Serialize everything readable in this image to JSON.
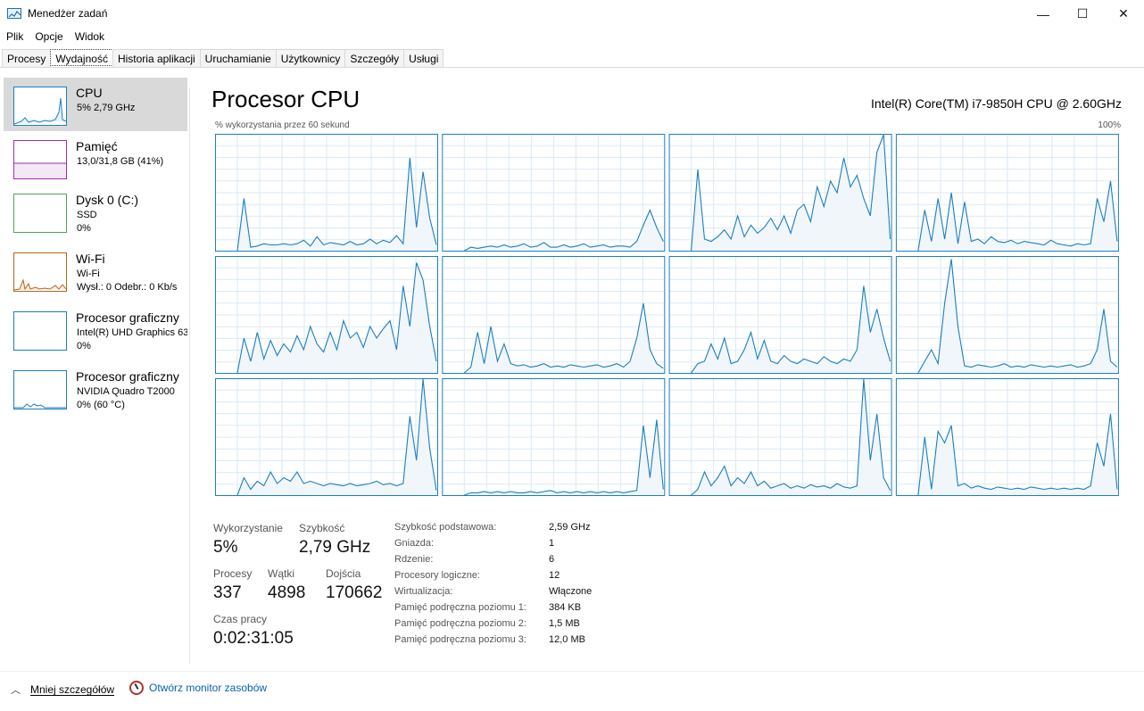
{
  "window": {
    "title": "Menedżer zadań",
    "minimize_glyph": "—",
    "maximize_glyph": "☐",
    "close_glyph": "✕"
  },
  "menu": [
    "Plik",
    "Opcje",
    "Widok"
  ],
  "tabs": [
    "Procesy",
    "Wydajność",
    "Historia aplikacji",
    "Uruchamianie",
    "Użytkownicy",
    "Szczegóły",
    "Usługi"
  ],
  "active_tab": "Wydajność",
  "sidebar": [
    {
      "title": "CPU",
      "lines": [
        "5% 2,79 GHz"
      ],
      "color": "#1a7fc1"
    },
    {
      "title": "Pamięć",
      "lines": [
        "13,0/31,8 GB (41%)"
      ],
      "color": "#9b30a8"
    },
    {
      "title": "Dysk 0 (C:)",
      "lines": [
        "SSD",
        "0%"
      ],
      "color": "#4da74d"
    },
    {
      "title": "Wi-Fi",
      "lines": [
        "Wi-Fi",
        "Wysł.: 0 Odebr.: 0 Kb/s"
      ],
      "color": "#b3661e"
    },
    {
      "title": "Procesor graficzny",
      "lines": [
        "Intel(R) UHD Graphics 63",
        "0%"
      ],
      "color": "#1a7fc1"
    },
    {
      "title": "Procesor graficzny",
      "lines": [
        "NVIDIA Quadro T2000",
        "0% (60 °C)"
      ],
      "color": "#1a7fc1"
    }
  ],
  "main": {
    "title": "Procesor CPU",
    "cpu_model": "Intel(R) Core(TM) i7-9850H CPU @ 2.60GHz",
    "axis_label": "% wykorzystania przez 60 sekund",
    "axis_max": "100%"
  },
  "stats": {
    "utilization_label": "Wykorzystanie",
    "utilization": "5%",
    "speed_label": "Szybkość",
    "speed": "2,79 GHz",
    "processes_label": "Procesy",
    "processes": "337",
    "threads_label": "Wątki",
    "threads": "4898",
    "handles_label": "Dojścia",
    "handles": "170662",
    "uptime_label": "Czas pracy",
    "uptime": "0:02:31:05"
  },
  "specs": [
    {
      "k": "Szybkość podstawowa:",
      "v": "2,59 GHz"
    },
    {
      "k": "Gniazda:",
      "v": "1"
    },
    {
      "k": "Rdzenie:",
      "v": "6"
    },
    {
      "k": "Procesory logiczne:",
      "v": "12"
    },
    {
      "k": "Wirtualizacja:",
      "v": "Włączone"
    },
    {
      "k": "Pamięć podręczna poziomu 1:",
      "v": "384 KB"
    },
    {
      "k": "Pamięć podręczna poziomu 2:",
      "v": "1,5 MB"
    },
    {
      "k": "Pamięć podręczna poziomu 3:",
      "v": "12,0 MB"
    }
  ],
  "footer": {
    "fewer_details": "Mniej szczegółów",
    "open_monitor": "Otwórz monitor zasobów"
  },
  "colors": {
    "cpu_line": "#1a7fc1",
    "cpu_fill": "#f1f6fb",
    "grid": "#d9eaf6"
  },
  "chart_data": {
    "type": "area",
    "ylim": [
      0,
      100
    ],
    "x_window_seconds": 60,
    "series": [
      {
        "values": [
          0,
          45,
          3,
          4,
          6,
          5,
          5,
          6,
          5,
          6,
          9,
          4,
          12,
          5,
          7,
          6,
          5,
          8,
          5,
          6,
          10,
          6,
          9,
          7,
          13,
          6,
          80,
          20,
          68,
          28,
          5
        ]
      },
      {
        "values": [
          0,
          3,
          2,
          3,
          4,
          3,
          5,
          3,
          4,
          6,
          3,
          4,
          7,
          3,
          3,
          5,
          3,
          4,
          6,
          3,
          4,
          5,
          3,
          4,
          4,
          3,
          8,
          22,
          35,
          20,
          8
        ]
      },
      {
        "values": [
          0,
          70,
          10,
          8,
          12,
          18,
          10,
          30,
          12,
          22,
          15,
          20,
          28,
          18,
          30,
          15,
          35,
          40,
          25,
          55,
          38,
          60,
          50,
          80,
          55,
          65,
          45,
          30,
          85,
          100,
          10
        ]
      },
      {
        "values": [
          0,
          35,
          8,
          45,
          10,
          50,
          6,
          42,
          8,
          10,
          6,
          12,
          8,
          7,
          9,
          6,
          8,
          7,
          6,
          5,
          9,
          6,
          5,
          4,
          6,
          5,
          6,
          45,
          25,
          60,
          8
        ]
      },
      {
        "values": [
          0,
          30,
          10,
          35,
          12,
          28,
          15,
          25,
          18,
          32,
          20,
          40,
          25,
          18,
          35,
          20,
          45,
          30,
          35,
          22,
          40,
          30,
          38,
          45,
          20,
          75,
          40,
          95,
          80,
          40,
          10
        ]
      },
      {
        "values": [
          0,
          5,
          35,
          8,
          40,
          10,
          25,
          8,
          6,
          7,
          5,
          6,
          8,
          5,
          6,
          5,
          7,
          6,
          5,
          6,
          7,
          5,
          6,
          8,
          5,
          10,
          30,
          60,
          20,
          8,
          4
        ]
      },
      {
        "values": [
          0,
          8,
          10,
          25,
          12,
          30,
          8,
          10,
          20,
          35,
          12,
          28,
          10,
          8,
          15,
          10,
          8,
          12,
          10,
          8,
          14,
          10,
          8,
          12,
          10,
          20,
          75,
          35,
          55,
          30,
          10
        ]
      },
      {
        "values": [
          0,
          10,
          20,
          8,
          60,
          98,
          40,
          6,
          5,
          7,
          6,
          5,
          6,
          8,
          5,
          6,
          5,
          7,
          6,
          5,
          6,
          5,
          6,
          7,
          5,
          6,
          8,
          20,
          55,
          10,
          5
        ]
      },
      {
        "values": [
          0,
          15,
          5,
          12,
          8,
          20,
          10,
          15,
          12,
          20,
          10,
          12,
          10,
          8,
          10,
          9,
          8,
          10,
          8,
          9,
          10,
          12,
          9,
          10,
          8,
          10,
          68,
          30,
          100,
          40,
          4
        ]
      },
      {
        "values": [
          0,
          2,
          2,
          3,
          2,
          3,
          2,
          3,
          2,
          2,
          3,
          2,
          3,
          4,
          2,
          3,
          2,
          3,
          2,
          3,
          2,
          3,
          2,
          3,
          2,
          3,
          4,
          60,
          15,
          65,
          5
        ]
      },
      {
        "values": [
          0,
          5,
          20,
          8,
          15,
          25,
          8,
          15,
          10,
          20,
          8,
          12,
          6,
          8,
          10,
          6,
          8,
          6,
          9,
          7,
          8,
          6,
          10,
          7,
          6,
          8,
          100,
          30,
          70,
          15,
          4
        ]
      },
      {
        "values": [
          0,
          50,
          5,
          55,
          45,
          60,
          8,
          10,
          6,
          8,
          6,
          5,
          7,
          6,
          5,
          6,
          5,
          7,
          6,
          5,
          6,
          5,
          6,
          5,
          6,
          5,
          8,
          45,
          25,
          70,
          5
        ]
      }
    ]
  }
}
